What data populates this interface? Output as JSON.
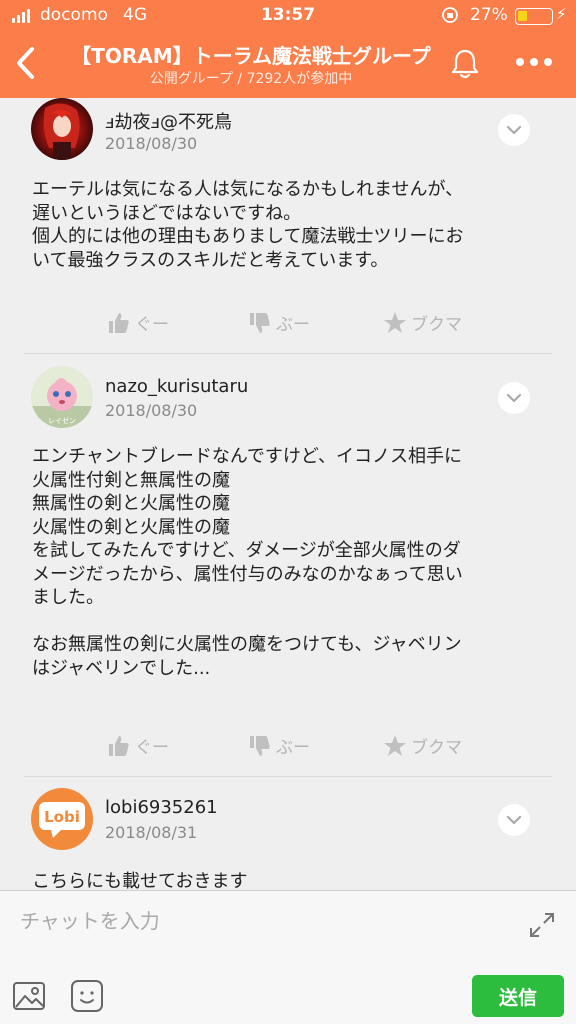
{
  "status_bar": {
    "carrier": "docomo",
    "network": "4G",
    "time": "13:57",
    "battery_percent": "27%",
    "battery_level": 0.27
  },
  "header": {
    "title": "【TORAM】トーラム魔法戦士グループ",
    "subtitle": "公開グループ / 7292人が参加中",
    "back_icon": "chevron-left-icon",
    "bell_icon": "bell-icon",
    "more_icon": "more-dots-icon"
  },
  "posts": [
    {
      "username": "ⅎ劫夜ⅎ@不死鳥",
      "date": "2018/08/30",
      "body": "エーテルは気になる人は気になるかもしれませんが、\n遅いというほどではないですね。\n個人的には他の理由もありまして魔法戦士ツリーにお\nいて最強クラスのスキルだと考えています。",
      "good_label": "ぐー",
      "bad_label": "ぶー",
      "bookmark_label": "ブクマ"
    },
    {
      "username": "nazo_kurisutaru",
      "date": "2018/08/30",
      "avatar_caption": "レイゼン",
      "body": "エンチャントブレードなんですけど、イコノス相手に\n火属性付剣と無属性の魔\n無属性の剣と火属性の魔\n火属性の剣と火属性の魔\nを試してみたんですけど、ダメージが全部火属性のダ\nメージだったから、属性付与のみなのかなぁって思い\nました。\n\nなお無属性の剣に火属性の魔をつけても、ジャベリン\nはジャベリンでした...",
      "good_label": "ぐー",
      "bad_label": "ぶー",
      "bookmark_label": "ブクマ"
    },
    {
      "username": "lobi6935261",
      "date": "2018/08/31",
      "avatar_text": "Lobi",
      "body": "こちらにも載せておきます"
    }
  ],
  "composer": {
    "placeholder": "チャットを入力",
    "send_label": "送信"
  },
  "colors": {
    "header": "#fa7d4a",
    "send": "#2dbd3e"
  }
}
